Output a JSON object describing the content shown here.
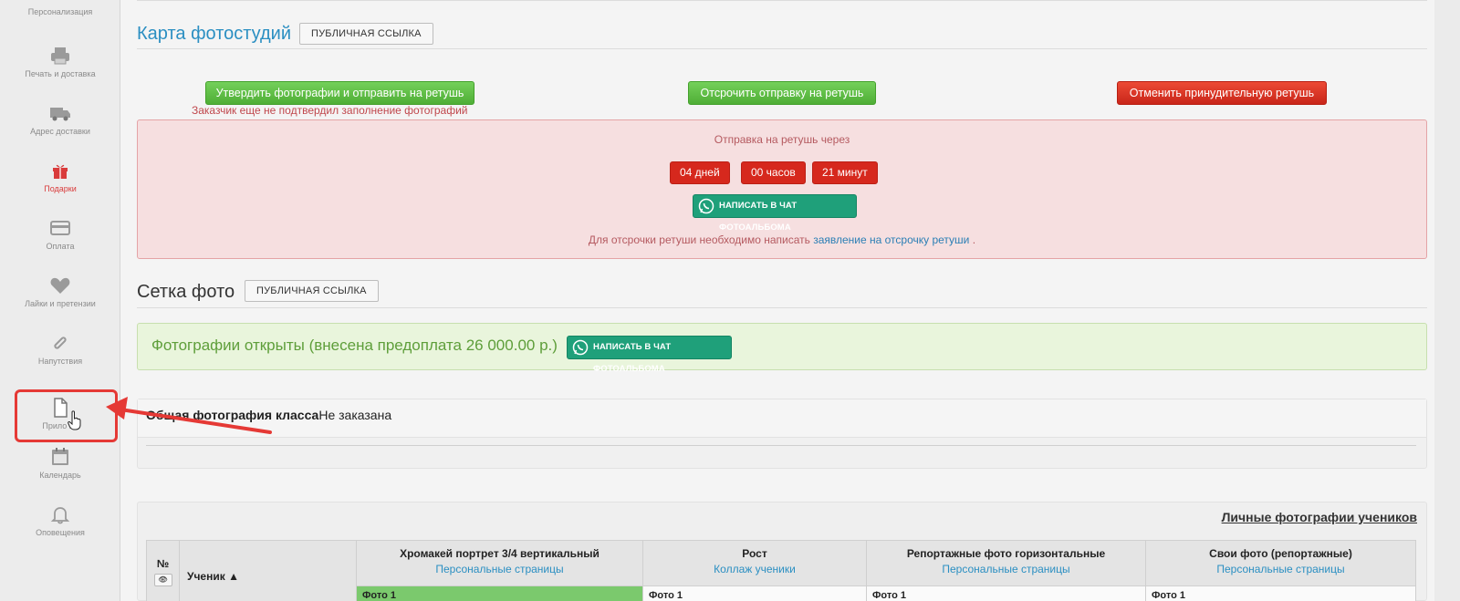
{
  "sidebar": {
    "items": [
      {
        "label": "Персонализация",
        "icon": "personalization-icon"
      },
      {
        "label": "Печать и доставка",
        "icon": "printer-icon"
      },
      {
        "label": "Адрес доставки",
        "icon": "truck-icon"
      },
      {
        "label": "Подарки",
        "icon": "gift-icon",
        "color": "#d93b3b"
      },
      {
        "label": "Оплата",
        "icon": "credit-card-icon"
      },
      {
        "label": "Лайки и претензии",
        "icon": "heart-icon"
      },
      {
        "label": "Напутствия",
        "icon": "paperclip-icon"
      },
      {
        "label": "Прило  ия",
        "icon": "file-icon"
      },
      {
        "label": "Календарь",
        "icon": "calendar-icon"
      },
      {
        "label": "Оповещения",
        "icon": "bell-icon"
      }
    ]
  },
  "studios": {
    "title": "Карта фотостудий",
    "public_link_label": "ПУБЛИЧНАЯ ССЫЛКА",
    "approve_button": "Утвердить фотографии и отправить на ретушь",
    "postpone_button": "Отсрочить отправку на ретушь",
    "cancel_button": "Отменить принудительную ретушь",
    "warning": "Заказчик еще не подтвердил заполнение фотографий"
  },
  "retouch": {
    "caption": "Отправка на ретушь через",
    "days": "04 дней",
    "hours": "00 часов",
    "minutes": "21 минут",
    "chat_button": "НАПИСАТЬ В ЧАТ ФОТОАЛЬБОМА",
    "note_prefix": "Для отсрочки ретуши необходимо написать",
    "note_link": "заявление на отсрочку ретуши",
    "note_suffix": "."
  },
  "grid": {
    "title": "Сетка фото",
    "public_link_label": "ПУБЛИЧНАЯ ССЫЛКА",
    "open_status": "Фотографии открыты (внесена предоплата 26 000.00 р.)",
    "chat_button": "НАПИСАТЬ В ЧАТ ФОТОАЛЬБОМА"
  },
  "class_photo": {
    "title": "Общая фотография класса",
    "status": "Не заказана"
  },
  "personal": {
    "link": "Личные фотографии учеников",
    "columns": {
      "num": "№",
      "student": "Ученик",
      "sort_icon": "caret-up-icon",
      "c1_title": "Хромакей портрет 3/4 вертикальный",
      "c1_sub": "Персональные страницы",
      "c2_title": "Рост",
      "c2_sub": "Коллаж ученики",
      "c3_title": "Репортажные фото горизонтальные",
      "c3_sub": "Персональные страницы",
      "c4_title": "Свои фото (репортажные)",
      "c4_sub": "Персональные страницы"
    },
    "row": {
      "c1": "Фото 1",
      "c2": "Фото 1",
      "c3": "Фото 1",
      "c4": "Фото 1"
    }
  },
  "colors": {
    "accent_blue": "#2b8fc2",
    "green": "#4fae36",
    "red": "#d6281d",
    "whatsapp": "#1fa07a"
  }
}
